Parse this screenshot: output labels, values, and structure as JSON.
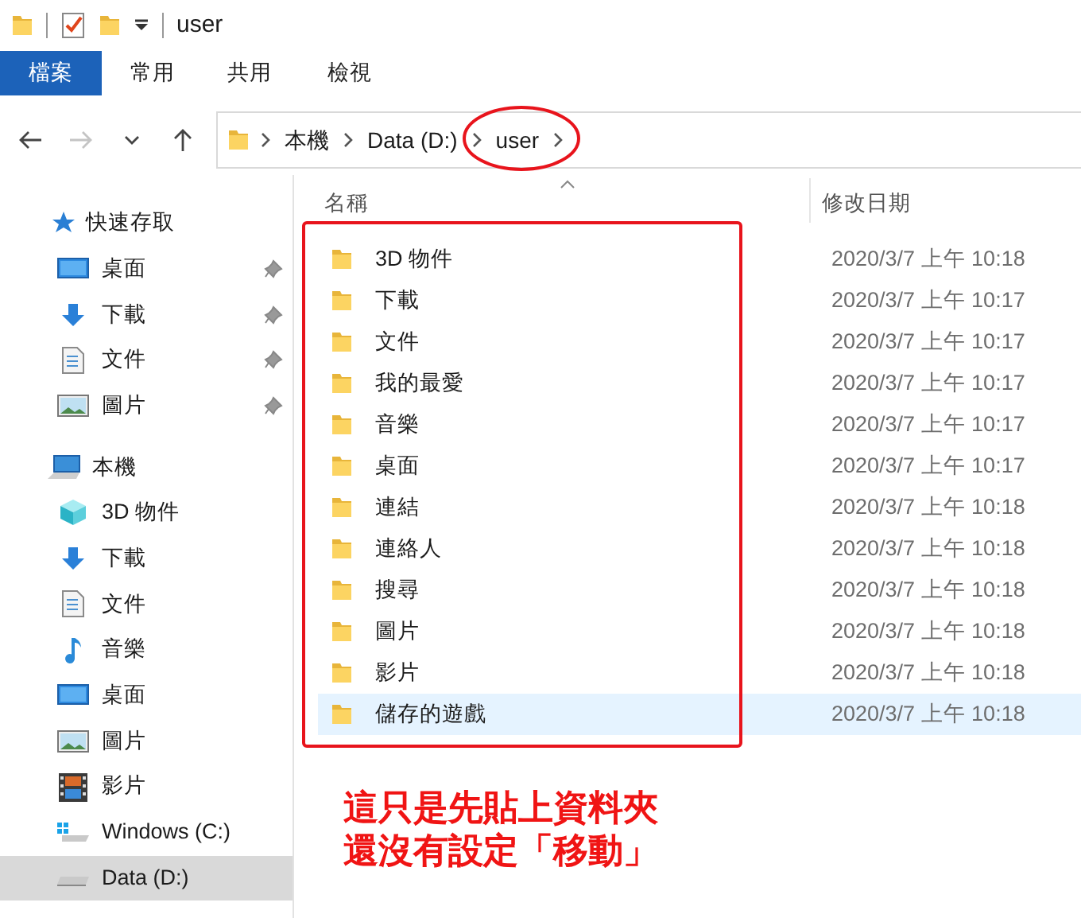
{
  "window": {
    "title": "user"
  },
  "quick_access_toolbar": [
    {
      "kind": "folder"
    },
    {
      "kind": "properties"
    },
    {
      "kind": "new-folder"
    },
    {
      "kind": "customize"
    }
  ],
  "ribbon_tabs": [
    {
      "label": "檔案",
      "selected": true
    },
    {
      "label": "常用",
      "selected": false
    },
    {
      "label": "共用",
      "selected": false
    },
    {
      "label": "檢視",
      "selected": false
    }
  ],
  "navigation": [
    {
      "kind": "back",
      "disabled": false
    },
    {
      "kind": "forward",
      "disabled": true
    },
    {
      "kind": "recent",
      "disabled": false
    },
    {
      "kind": "up",
      "disabled": false
    }
  ],
  "address_bar": {
    "crumbs": [
      "本機",
      "Data (D:)",
      "user"
    ]
  },
  "sidebar": {
    "sections": [
      {
        "label": "快速存取",
        "kind": "star",
        "children": [
          {
            "label": "桌面",
            "kind": "desktop",
            "pinned": true,
            "selected": false
          },
          {
            "label": "下載",
            "kind": "download",
            "pinned": true,
            "selected": false
          },
          {
            "label": "文件",
            "kind": "document",
            "pinned": true,
            "selected": false
          },
          {
            "label": "圖片",
            "kind": "pictures",
            "pinned": true,
            "selected": false
          }
        ]
      },
      {
        "label": "本機",
        "kind": "pc",
        "children": [
          {
            "label": "3D 物件",
            "kind": "cube",
            "pinned": false,
            "selected": false
          },
          {
            "label": "下載",
            "kind": "download",
            "pinned": false,
            "selected": false
          },
          {
            "label": "文件",
            "kind": "document",
            "pinned": false,
            "selected": false
          },
          {
            "label": "音樂",
            "kind": "music",
            "pinned": false,
            "selected": false
          },
          {
            "label": "桌面",
            "kind": "desktop",
            "pinned": false,
            "selected": false
          },
          {
            "label": "圖片",
            "kind": "pictures",
            "pinned": false,
            "selected": false
          },
          {
            "label": "影片",
            "kind": "video",
            "pinned": false,
            "selected": false
          },
          {
            "label": "Windows (C:)",
            "kind": "windows-drive",
            "pinned": false,
            "selected": false
          },
          {
            "label": "Data (D:)",
            "kind": "drive",
            "pinned": false,
            "selected": true
          }
        ]
      }
    ]
  },
  "file_list": {
    "columns": [
      "名稱",
      "修改日期"
    ],
    "rows": [
      {
        "name": "3D 物件",
        "modified": "2020/3/7 上午 10:18",
        "selected": false
      },
      {
        "name": "下載",
        "modified": "2020/3/7 上午 10:17",
        "selected": false
      },
      {
        "name": "文件",
        "modified": "2020/3/7 上午 10:17",
        "selected": false
      },
      {
        "name": "我的最愛",
        "modified": "2020/3/7 上午 10:17",
        "selected": false
      },
      {
        "name": "音樂",
        "modified": "2020/3/7 上午 10:17",
        "selected": false
      },
      {
        "name": "桌面",
        "modified": "2020/3/7 上午 10:17",
        "selected": false
      },
      {
        "name": "連結",
        "modified": "2020/3/7 上午 10:18",
        "selected": false
      },
      {
        "name": "連絡人",
        "modified": "2020/3/7 上午 10:18",
        "selected": false
      },
      {
        "name": "搜尋",
        "modified": "2020/3/7 上午 10:18",
        "selected": false
      },
      {
        "name": "圖片",
        "modified": "2020/3/7 上午 10:18",
        "selected": false
      },
      {
        "name": "影片",
        "modified": "2020/3/7 上午 10:18",
        "selected": false
      },
      {
        "name": "儲存的遊戲",
        "modified": "2020/3/7 上午 10:18",
        "selected": true
      }
    ]
  },
  "annotation": {
    "lines": [
      "這只是先貼上資料夾",
      "還沒有設定「移動」"
    ]
  }
}
